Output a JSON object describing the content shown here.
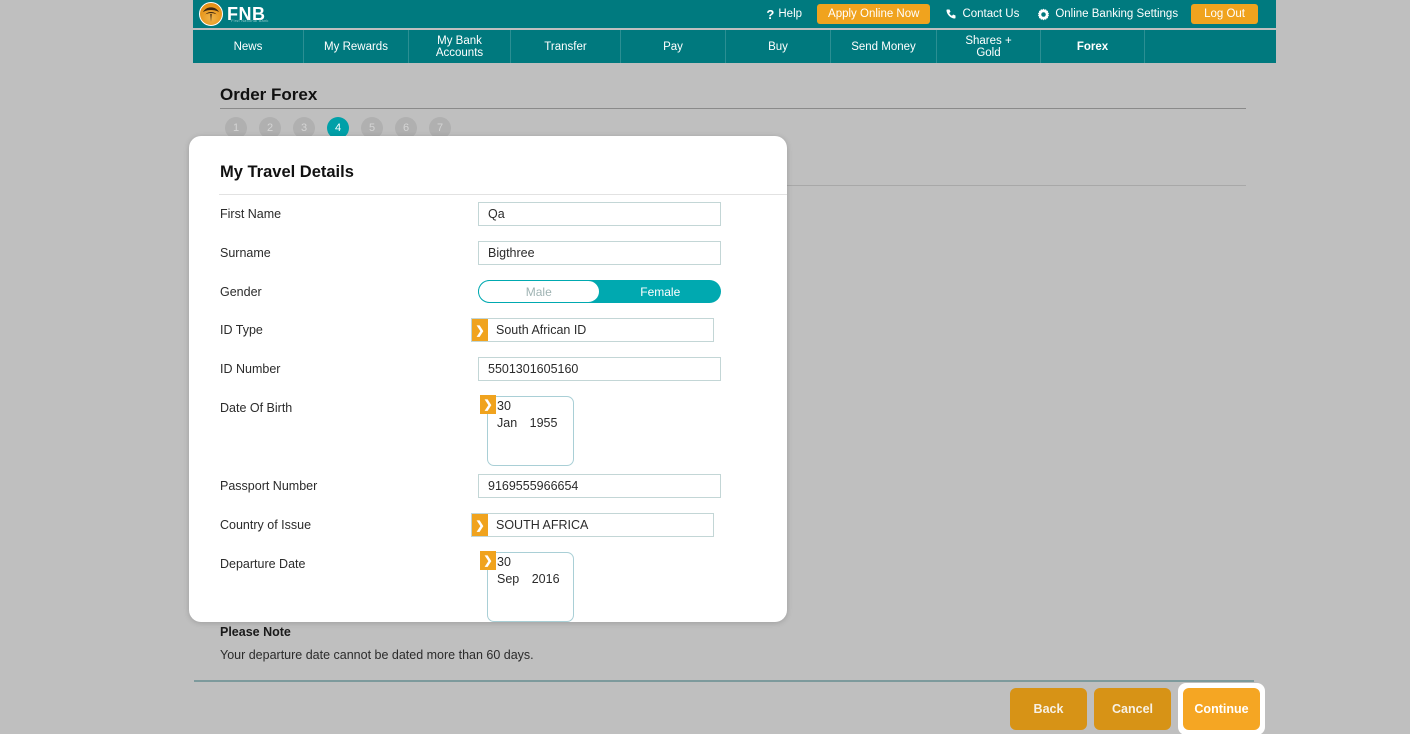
{
  "header": {
    "logo": {
      "name": "FNB",
      "tagline": "First National Bank"
    },
    "right_items": [
      {
        "type": "link",
        "icon": "question-mark-icon",
        "label": "Help"
      },
      {
        "type": "button",
        "label": "Apply Online Now"
      },
      {
        "type": "link",
        "icon": "phone-icon",
        "label": "Contact Us"
      },
      {
        "type": "link",
        "icon": "gear-icon",
        "label": "Online Banking Settings"
      },
      {
        "type": "button",
        "label": "Log Out"
      }
    ]
  },
  "nav": {
    "items": [
      {
        "label": "News",
        "active": false
      },
      {
        "label": "My Rewards",
        "active": false
      },
      {
        "label": "My Bank\nAccounts",
        "active": false
      },
      {
        "label": "Transfer",
        "active": false
      },
      {
        "label": "Pay",
        "active": false
      },
      {
        "label": "Buy",
        "active": false
      },
      {
        "label": "Send Money",
        "active": false
      },
      {
        "label": "Shares +\nGold",
        "active": false
      },
      {
        "label": "Forex",
        "active": true
      }
    ],
    "labels": {
      "news": "News",
      "my_rewards": "My Rewards",
      "my_bank_accounts_line1": "My Bank",
      "my_bank_accounts_line2": "Accounts",
      "transfer": "Transfer",
      "pay": "Pay",
      "buy": "Buy",
      "send_money": "Send Money",
      "shares_gold_line1": "Shares +",
      "shares_gold_line2": "Gold",
      "forex": "Forex"
    }
  },
  "page": {
    "title": "Order Forex",
    "steps": [
      "1",
      "2",
      "3",
      "4",
      "5",
      "6",
      "7"
    ],
    "active_step": 4
  },
  "modal": {
    "title": "My Travel Details",
    "fields": {
      "first_name": {
        "label": "First Name",
        "value": "Qa"
      },
      "surname": {
        "label": "Surname",
        "value": "Bigthree"
      },
      "gender": {
        "label": "Gender",
        "option_male": "Male",
        "option_female": "Female",
        "selected": "Female"
      },
      "id_type": {
        "label": "ID Type",
        "value": "South African ID"
      },
      "id_number": {
        "label": "ID Number",
        "value": "5501301605160"
      },
      "date_of_birth": {
        "label": "Date Of Birth",
        "day": "30",
        "month": "Jan",
        "year": "1955"
      },
      "passport_number": {
        "label": "Passport Number",
        "value": "9169555966654"
      },
      "country_of_issue": {
        "label": "Country of Issue",
        "value": "SOUTH AFRICA"
      },
      "departure_date": {
        "label": "Departure Date",
        "day": "30",
        "month": "Sep",
        "year": "2016"
      }
    }
  },
  "note": {
    "title": "Please Note",
    "body": "Your departure date cannot be dated more than 60 days."
  },
  "actions": {
    "back": "Back",
    "cancel": "Cancel",
    "continue": "Continue"
  },
  "colors": {
    "teal_header": "#007a7f",
    "teal_nav": "#00797e",
    "accent_orange": "#f0a31e",
    "primary_button": "#f5a623",
    "secondary_button": "#d79316",
    "step_active": "#00a0a8",
    "toggle_on": "#00a9b0",
    "page_background": "#bfbfbf"
  }
}
